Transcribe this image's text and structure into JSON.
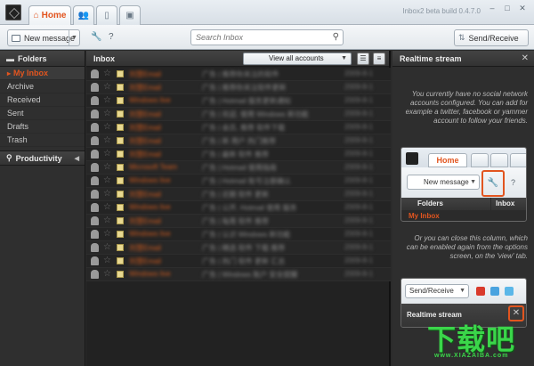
{
  "titlebar": {
    "tabs": [
      {
        "label": "Home",
        "icon": "home-icon"
      },
      {
        "label": "",
        "icon": "contacts-icon"
      },
      {
        "label": "",
        "icon": "document-icon"
      },
      {
        "label": "",
        "icon": "image-icon"
      }
    ],
    "build_label": "Inbox2 beta build 0.4.7.0",
    "window_controls": [
      "minimize",
      "maximize",
      "close"
    ]
  },
  "toolbar": {
    "new_message_label": "New message",
    "search_placeholder": "Search Inbox",
    "send_receive_label": "Send/Receive"
  },
  "sidebar": {
    "folders_header": "Folders",
    "items": [
      {
        "label": "My Inbox",
        "active": true
      },
      {
        "label": "Archive"
      },
      {
        "label": "Received"
      },
      {
        "label": "Sent"
      },
      {
        "label": "Drafts"
      },
      {
        "label": "Trash"
      }
    ],
    "productivity_label": "Productivity"
  },
  "inbox": {
    "title": "Inbox",
    "account_filter": "View all accounts",
    "rows": [
      {
        "sender": "刘慧Email",
        "subject": "广告 | 推荐你关注的软件",
        "date": "2009-8-1"
      },
      {
        "sender": "刘慧Email",
        "subject": "广告 | 推荐你关注软件更新",
        "date": "2009-8-1"
      },
      {
        "sender": "Windows live",
        "subject": "广告 | Hotmail 服务更新通知",
        "date": "2009-8-1"
      },
      {
        "sender": "刘慧Email",
        "subject": "广告 | 欢迎, 使用 Windows 新功能",
        "date": "2009-8-1"
      },
      {
        "sender": "刘慧Email",
        "subject": "广告 | 会员, 推荐 软件下载",
        "date": "2009-8-1"
      },
      {
        "sender": "刘慧Email",
        "subject": "广告 | 新 用户 热门推荐",
        "date": "2009-8-1"
      },
      {
        "sender": "刘慧Email",
        "subject": "广告 | 最新 软件 推荐",
        "date": "2009-8-1"
      },
      {
        "sender": "Microsoft Team",
        "subject": "广告 | Hotmail 使用指南",
        "date": "2009-8-1"
      },
      {
        "sender": "Windows live",
        "subject": "广告 | Hotmail 账号注册确认",
        "date": "2009-8-1"
      },
      {
        "sender": "刘慧Email",
        "subject": "广告 | 近期 软件 更新",
        "date": "2009-8-1"
      },
      {
        "sender": "Windows live",
        "subject": "广告 | 公开, Hotmail 使用 服务",
        "date": "2009-8-1"
      },
      {
        "sender": "刘慧Email",
        "subject": "广告 | 每周 软件 推荐",
        "date": "2009-8-1"
      },
      {
        "sender": "Windows live",
        "subject": "广告 | 认识 Windows 新功能",
        "date": "2009-8-1"
      },
      {
        "sender": "刘慧Email",
        "subject": "广告 | 精选 软件 下载 推荐",
        "date": "2009-8-1"
      },
      {
        "sender": "刘慧Email",
        "subject": "广告 | 热门 软件 更新 汇总",
        "date": "2009-8-1"
      },
      {
        "sender": "Windows live",
        "subject": "广告 | Windows 账户 安全提醒",
        "date": "2009-8-1"
      }
    ]
  },
  "realtime": {
    "title": "Realtime stream",
    "intro_text": "You currently have no social network accounts configured. You can add for example a twitter, facebook or yammer account to follow your friends.",
    "close_text": "Or you can close this column, which can be enabled again from the options screen, on the 'view' tab.",
    "thumb1": {
      "home": "Home",
      "new_message": "New message",
      "folders": "Folders",
      "inbox": "Inbox",
      "my_inbox": "My Inbox"
    },
    "thumb2": {
      "send_receive": "Send/Receive",
      "title": "Realtime stream"
    }
  },
  "watermark": {
    "text": "下载吧",
    "url": "www.XIAZAIBA.com"
  },
  "colors": {
    "accent": "#e2551f",
    "dark_panel": "#2b2b2b",
    "watermark": "#3bd54a"
  }
}
